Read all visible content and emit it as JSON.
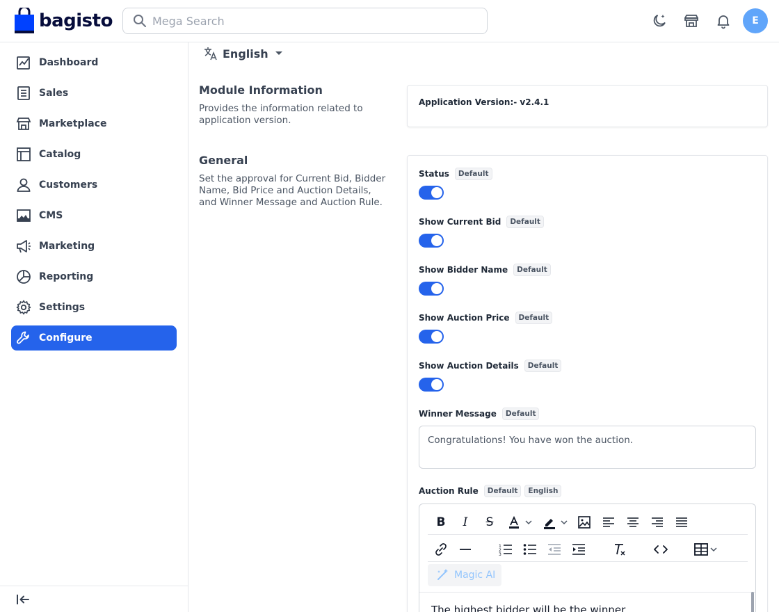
{
  "brand": {
    "name": "bagisto",
    "color": "#0041ff"
  },
  "search": {
    "placeholder": "Mega Search"
  },
  "header": {
    "icons": [
      "dark-mode-icon",
      "store-icon",
      "bell-icon"
    ],
    "avatar_initial": "E"
  },
  "sidebar": {
    "items": [
      {
        "label": "Dashboard",
        "icon": "dashboard-icon"
      },
      {
        "label": "Sales",
        "icon": "sales-icon"
      },
      {
        "label": "Marketplace",
        "icon": "marketplace-icon"
      },
      {
        "label": "Catalog",
        "icon": "catalog-icon"
      },
      {
        "label": "Customers",
        "icon": "customers-icon"
      },
      {
        "label": "CMS",
        "icon": "cms-icon"
      },
      {
        "label": "Marketing",
        "icon": "marketing-icon"
      },
      {
        "label": "Reporting",
        "icon": "reporting-icon"
      },
      {
        "label": "Settings",
        "icon": "settings-icon"
      },
      {
        "label": "Configure",
        "icon": "configure-icon",
        "active": true
      }
    ],
    "active_color": "#2563eb"
  },
  "locale": {
    "label": "English"
  },
  "module_info": {
    "title": "Module Information",
    "description": "Provides the information related to application version.",
    "version_text": "Application Version:- v2.4.1"
  },
  "general": {
    "title": "General",
    "description": "Set the approval for Current Bid, Bidder Name, Bid Price and Auction Details, and Winner Message and Auction Rule.",
    "toggles": [
      {
        "label": "Status",
        "badge": "Default",
        "on": true
      },
      {
        "label": "Show Current Bid",
        "badge": "Default",
        "on": true
      },
      {
        "label": "Show Bidder Name",
        "badge": "Default",
        "on": true
      },
      {
        "label": "Show Auction Price",
        "badge": "Default",
        "on": true
      },
      {
        "label": "Show Auction Details",
        "badge": "Default",
        "on": true
      }
    ],
    "winner_message": {
      "label": "Winner Message",
      "badge": "Default",
      "value": "Congratulations! You have won the auction."
    },
    "auction_rule": {
      "label": "Auction Rule",
      "badges": [
        "Default",
        "English"
      ],
      "magic_ai_label": "Magic AI",
      "content": "The highest bidder will be the winner."
    }
  }
}
